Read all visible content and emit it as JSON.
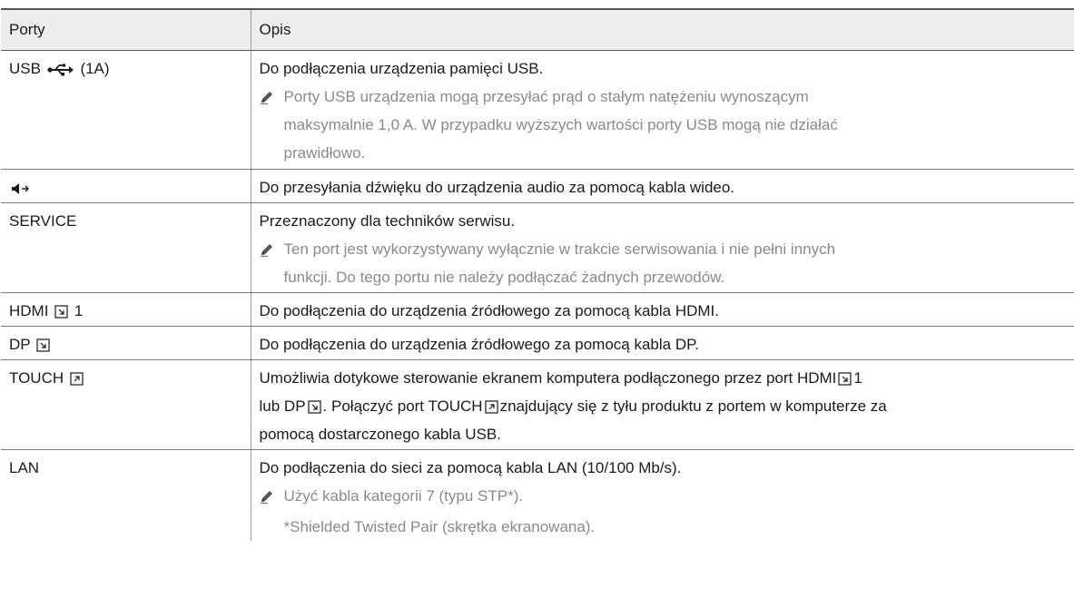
{
  "header": {
    "col1": "Porty",
    "col2": "Opis"
  },
  "rows": [
    {
      "port": "USB",
      "port_suffix": "(1A)",
      "desc": "Do podłączenia urządzenia pamięci USB.",
      "note_lines": [
        "Porty USB urządzenia mogą przesyłać prąd o stałym natężeniu wynoszącym",
        "maksymalnie 1,0 A. W przypadku wyższych wartości porty USB mogą nie działać",
        "prawidłowo."
      ]
    },
    {
      "port": "",
      "desc": "Do przesyłania dźwięku do urządzenia audio za pomocą kabla wideo."
    },
    {
      "port": "SERVICE",
      "desc": "Przeznaczony dla techników serwisu.",
      "note_lines": [
        "Ten port jest wykorzystywany wyłącznie w trakcie serwisowania i nie pełni innych",
        "funkcji. Do tego portu nie należy podłączać żadnych przewodów."
      ]
    },
    {
      "port": "HDMI",
      "port_suffix": "1",
      "desc": "Do podłączenia do urządzenia źródłowego za pomocą kabla HDMI."
    },
    {
      "port": "DP",
      "desc": "Do podłączenia do urządzenia źródłowego za pomocą kabla DP."
    },
    {
      "port": "TOUCH",
      "desc_parts": {
        "a": "Umożliwia dotykowe sterowanie ekranem komputera podłączonego przez port ",
        "b": "HDMI",
        "c": "1",
        "d": "lub ",
        "e": "DP",
        "f": ". Połączyć port ",
        "g": "TOUCH",
        "h": "znajdujący się z tyłu produktu z portem w komputerze za",
        "i": "pomocą dostarczonego kabla USB."
      }
    },
    {
      "port": "LAN",
      "desc": "Do podłączenia do sieci za pomocą kabla LAN (10/100 Mb/s).",
      "note_lines": [
        "Użyć kabla kategorii 7 (typu STP*)."
      ],
      "subnote": "*Shielded Twisted Pair (skrętka ekranowana)."
    }
  ],
  "icons": {
    "usb": "usb-icon",
    "audio_out": "speaker-out-icon",
    "source_input": "source-input-icon",
    "touch_out": "touch-output-icon",
    "note": "pencil-note-icon"
  },
  "colors": {
    "header_bg": "#eeeeee",
    "note_text": "#8a8a8a",
    "text": "#1a1a1a"
  }
}
